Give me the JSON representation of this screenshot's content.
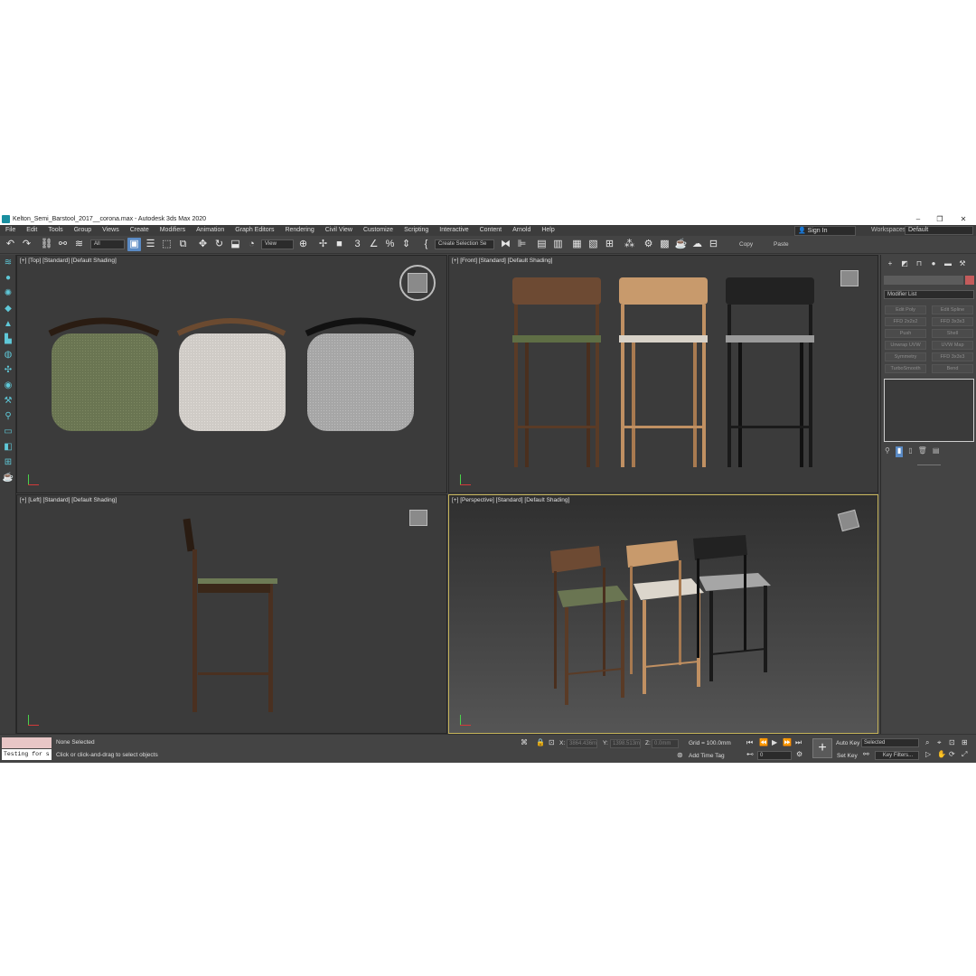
{
  "window": {
    "title": "Kelton_Semi_Barstool_2017__corona.max - Autodesk 3ds Max 2020",
    "minimize": "–",
    "maximize": "❐",
    "close": "✕"
  },
  "menubar": {
    "items": [
      "File",
      "Edit",
      "Tools",
      "Group",
      "Views",
      "Create",
      "Modifiers",
      "Animation",
      "Graph Editors",
      "Rendering",
      "Civil View",
      "Customize",
      "Scripting",
      "Interactive",
      "Content",
      "Arnold",
      "Help"
    ],
    "sign_in": "Sign In",
    "workspaces_label": "Workspaces:",
    "workspaces_value": "Default"
  },
  "toolbar": {
    "filter_value": "All",
    "coord_value": "View",
    "selection_set": "Create Selection Se",
    "copy_label": "Copy",
    "paste_label": "Paste"
  },
  "viewports": {
    "top": {
      "label": "[+] [Top] [Standard] [Default Shading]"
    },
    "front": {
      "label": "[+] [Front] [Standard] [Default Shading]"
    },
    "left": {
      "label": "[+] [Left] [Standard] [Default Shading]"
    },
    "perspective": {
      "label": "[+] [Perspective] [Standard] [Default Shading]"
    }
  },
  "command_panel": {
    "modifier_list": "Modifier List",
    "modifier_buttons": [
      "Edit Poly",
      "Edit Spline",
      "FFD 2x2x2",
      "FFD 3x3x3",
      "Push",
      "Shell",
      "Unwrap UVW",
      "UVW Map",
      "Symmetry",
      "FFD 3x3x3",
      "TurboSmooth",
      "Bend"
    ]
  },
  "status": {
    "maxscript_text": "Testing for s",
    "selection_status": "None Selected",
    "prompt": "Click or click-and-drag to select objects",
    "x_label": "X:",
    "x_value": "3864.436m",
    "y_label": "Y:",
    "y_value": "1398.513m",
    "z_label": "Z:",
    "z_value": "0.0mm",
    "grid": "Grid = 100.0mm",
    "add_time_tag": "Add Time Tag",
    "frame_value": "0",
    "auto_key": "Auto Key",
    "set_key": "Set Key",
    "key_mode": "Selected",
    "key_filters": "Key Filters..."
  },
  "colors": {
    "accent_selected": "#5a8ac4",
    "active_viewport_border": "#c6b45a",
    "ui_background": "#444444",
    "viewport_background": "#3b3b3b"
  }
}
